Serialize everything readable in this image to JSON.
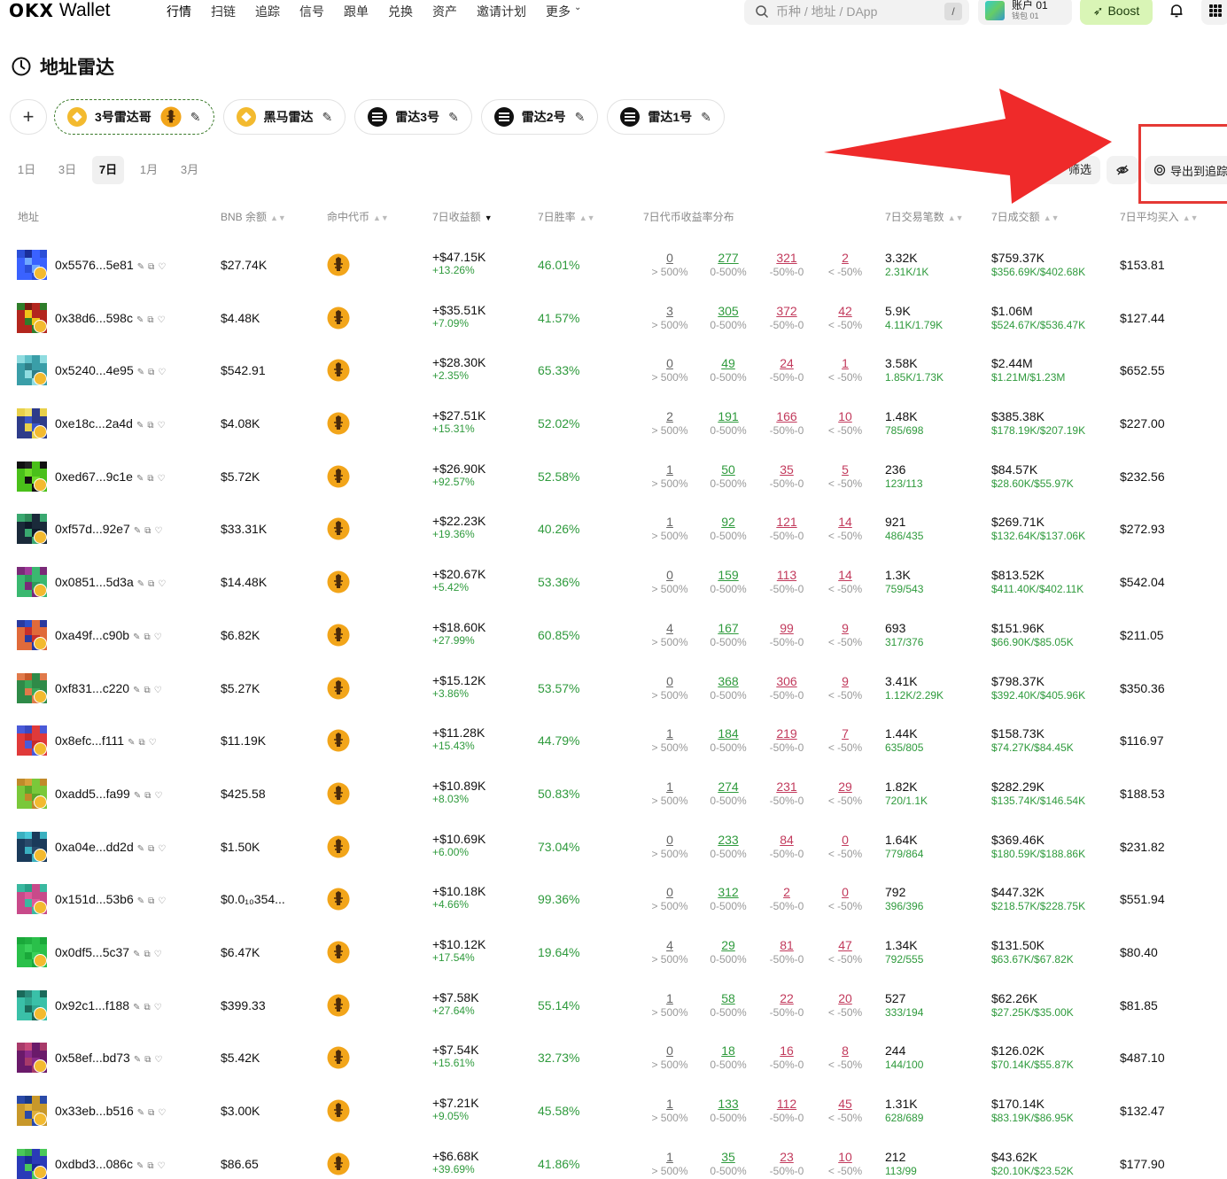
{
  "nav": {
    "logo_mark": "OKX",
    "logo_text": "Wallet",
    "links": [
      "行情",
      "扫链",
      "追踪",
      "信号",
      "跟单",
      "兑换",
      "资产",
      "邀请计划",
      "更多"
    ],
    "search_placeholder": "币种 / 地址 / DApp",
    "search_shortcut": "/",
    "account_name": "账户 01",
    "account_sub": "钱包 01",
    "boost_label": "Boost"
  },
  "page": {
    "title": "地址雷达"
  },
  "radar_tabs": [
    {
      "label": "3号雷达哥",
      "chain": "bnb",
      "selected": true
    },
    {
      "label": "黑马雷达",
      "chain": "bnb",
      "selected": false
    },
    {
      "label": "雷达3号",
      "chain": "sol",
      "selected": false
    },
    {
      "label": "雷达2号",
      "chain": "sol",
      "selected": false
    },
    {
      "label": "雷达1号",
      "chain": "sol",
      "selected": false
    }
  ],
  "add_tab_label": "+",
  "time_filters": [
    "1日",
    "3日",
    "7日",
    "1月",
    "3月"
  ],
  "active_time_filter": "7日",
  "toolbar": {
    "filter_label": "筛选",
    "export_label": "导出到追踪"
  },
  "columns": {
    "address": "地址",
    "balance": "BNB 余额",
    "token": "命中代币",
    "profit": "7日收益额",
    "winrate": "7日胜率",
    "dist": "7日代币收益率分布",
    "txcount": "7日交易笔数",
    "volume": "7日成交额",
    "avgbuy": "7日平均买入"
  },
  "dist_labels": [
    "> 500%",
    "0-500%",
    "-50%-0",
    "< -50%"
  ],
  "rows": [
    {
      "addr": "0x5576...5e81",
      "bal": "$27.74K",
      "profit": "+$47.15K",
      "pct": "+13.26%",
      "win": "46.01%",
      "d": [
        "0",
        "277",
        "321",
        "2"
      ],
      "tx": "3.32K",
      "txs": "2.31K/1K",
      "vol": "$759.37K",
      "vols": "$356.69K/$402.68K",
      "avg": "$153.81",
      "c": [
        "#2b4fd8",
        "#6fa8ff",
        "#1a2f9a",
        "#3a62ff"
      ]
    },
    {
      "addr": "0x38d6...598c",
      "bal": "$4.48K",
      "profit": "+$35.51K",
      "pct": "+7.09%",
      "win": "41.57%",
      "d": [
        "3",
        "305",
        "372",
        "42"
      ],
      "tx": "5.9K",
      "txs": "4.11K/1.79K",
      "vol": "$1.06M",
      "vols": "$524.67K/$536.47K",
      "avg": "$127.44",
      "c": [
        "#b3261e",
        "#2f7d2a",
        "#f0c419",
        "#7a1a12"
      ]
    },
    {
      "addr": "0x5240...4e95",
      "bal": "$542.91",
      "profit": "+$28.30K",
      "pct": "+2.35%",
      "win": "65.33%",
      "d": [
        "0",
        "49",
        "24",
        "1"
      ],
      "tx": "3.58K",
      "txs": "1.85K/1.73K",
      "vol": "$2.44M",
      "vols": "$1.21M/$1.23M",
      "avg": "$652.55",
      "c": [
        "#5fc0c8",
        "#3a9ea8",
        "#8fdce0",
        "#2f7f88"
      ]
    },
    {
      "addr": "0xe18c...2a4d",
      "bal": "$4.08K",
      "profit": "+$27.51K",
      "pct": "+15.31%",
      "win": "52.02%",
      "d": [
        "2",
        "191",
        "166",
        "10"
      ],
      "tx": "1.48K",
      "txs": "785/698",
      "vol": "$385.38K",
      "vols": "$178.19K/$207.19K",
      "avg": "$227.00",
      "c": [
        "#3a56c8",
        "#f2e06a",
        "#2e3c8a",
        "#e8d04a"
      ]
    },
    {
      "addr": "0xed67...9c1e",
      "bal": "$5.72K",
      "profit": "+$26.90K",
      "pct": "+92.57%",
      "win": "52.58%",
      "d": [
        "1",
        "50",
        "35",
        "5"
      ],
      "tx": "236",
      "txs": "123/113",
      "vol": "$84.57K",
      "vols": "$28.60K/$55.97K",
      "avg": "$232.56",
      "c": [
        "#111111",
        "#6fdc2a",
        "#222222",
        "#4ac01a"
      ]
    },
    {
      "addr": "0xf57d...92e7",
      "bal": "$33.31K",
      "profit": "+$22.23K",
      "pct": "+19.36%",
      "win": "40.26%",
      "d": [
        "1",
        "92",
        "121",
        "14"
      ],
      "tx": "921",
      "txs": "486/435",
      "vol": "$269.71K",
      "vols": "$132.64K/$137.06K",
      "avg": "$272.93",
      "c": [
        "#1a2a3a",
        "#3aa870",
        "#0f1a2a",
        "#2f8a5a"
      ]
    },
    {
      "addr": "0x0851...5d3a",
      "bal": "$14.48K",
      "profit": "+$20.67K",
      "pct": "+5.42%",
      "win": "53.36%",
      "d": [
        "0",
        "159",
        "113",
        "14"
      ],
      "tx": "1.3K",
      "txs": "759/543",
      "vol": "$813.52K",
      "vols": "$411.40K/$402.11K",
      "avg": "$542.04",
      "c": [
        "#a03a9a",
        "#3ab870",
        "#7a2a78",
        "#2f9a5a"
      ]
    },
    {
      "addr": "0xa49f...c90b",
      "bal": "$6.82K",
      "profit": "+$18.60K",
      "pct": "+27.99%",
      "win": "60.85%",
      "d": [
        "4",
        "167",
        "99",
        "9"
      ],
      "tx": "693",
      "txs": "317/376",
      "vol": "$151.96K",
      "vols": "$66.90K/$85.05K",
      "avg": "$211.05",
      "c": [
        "#c8302a",
        "#3050c8",
        "#e06a3a",
        "#2a3aa0"
      ]
    },
    {
      "addr": "0xf831...c220",
      "bal": "$5.27K",
      "profit": "+$15.12K",
      "pct": "+3.86%",
      "win": "53.57%",
      "d": [
        "0",
        "368",
        "306",
        "9"
      ],
      "tx": "3.41K",
      "txs": "1.12K/2.29K",
      "vol": "$798.37K",
      "vols": "$392.40K/$405.96K",
      "avg": "$350.36",
      "c": [
        "#e07a4a",
        "#3aa858",
        "#c85a2a",
        "#2f8a48"
      ]
    },
    {
      "addr": "0x8efc...f111",
      "bal": "$11.19K",
      "profit": "+$11.28K",
      "pct": "+15.43%",
      "win": "44.79%",
      "d": [
        "1",
        "184",
        "219",
        "7"
      ],
      "tx": "1.44K",
      "txs": "635/805",
      "vol": "$158.73K",
      "vols": "$74.27K/$84.45K",
      "avg": "$116.97",
      "c": [
        "#e03a3a",
        "#4a5ad8",
        "#c82a2a",
        "#3a4ac0"
      ]
    },
    {
      "addr": "0xadd5...fa99",
      "bal": "$425.58",
      "profit": "+$10.89K",
      "pct": "+8.03%",
      "win": "50.83%",
      "d": [
        "1",
        "274",
        "231",
        "29"
      ],
      "tx": "1.82K",
      "txs": "720/1.1K",
      "vol": "$282.29K",
      "vols": "$135.74K/$146.54K",
      "avg": "$188.53",
      "c": [
        "#d8a03a",
        "#7ac83a",
        "#c08a2a",
        "#5aa82a"
      ]
    },
    {
      "addr": "0xa04e...dd2d",
      "bal": "$1.50K",
      "profit": "+$10.69K",
      "pct": "+6.00%",
      "win": "73.04%",
      "d": [
        "0",
        "233",
        "84",
        "0"
      ],
      "tx": "1.64K",
      "txs": "779/864",
      "vol": "$369.46K",
      "vols": "$180.59K/$188.86K",
      "avg": "$231.82",
      "c": [
        "#2a4a6a",
        "#4ac8d8",
        "#1a3a5a",
        "#3ab0c0"
      ]
    },
    {
      "addr": "0x151d...53b6",
      "bal": "$0.0₁₀354...",
      "profit": "+$10.18K",
      "pct": "+4.66%",
      "win": "99.36%",
      "d": [
        "0",
        "312",
        "2",
        "0"
      ],
      "tx": "792",
      "txs": "396/396",
      "vol": "$447.32K",
      "vols": "$218.57K/$228.75K",
      "avg": "$551.94",
      "c": [
        "#3ab8a0",
        "#e05a9a",
        "#2aa088",
        "#c84a8a"
      ]
    },
    {
      "addr": "0x0df5...5c37",
      "bal": "$6.47K",
      "profit": "+$10.12K",
      "pct": "+17.54%",
      "win": "19.64%",
      "d": [
        "4",
        "29",
        "81",
        "47"
      ],
      "tx": "1.34K",
      "txs": "792/555",
      "vol": "$131.50K",
      "vols": "$63.67K/$67.82K",
      "avg": "$80.40",
      "c": [
        "#2ac04a",
        "#1aa83a",
        "#3ad05a",
        "#20b040"
      ]
    },
    {
      "addr": "0x92c1...f188",
      "bal": "$399.33",
      "profit": "+$7.58K",
      "pct": "+27.64%",
      "win": "55.14%",
      "d": [
        "1",
        "58",
        "22",
        "20"
      ],
      "tx": "527",
      "txs": "333/194",
      "vol": "$62.26K",
      "vols": "$27.25K/$35.00K",
      "avg": "$81.85",
      "c": [
        "#2a8a7a",
        "#3ac0a8",
        "#1a6a5a",
        "#2fa890"
      ]
    },
    {
      "addr": "0x58ef...bd73",
      "bal": "$5.42K",
      "profit": "+$7.54K",
      "pct": "+15.61%",
      "win": "32.73%",
      "d": [
        "0",
        "18",
        "16",
        "8"
      ],
      "tx": "244",
      "txs": "144/100",
      "vol": "$126.02K",
      "vols": "$70.14K/$55.87K",
      "avg": "$487.10",
      "c": [
        "#8a2a8a",
        "#c84a7a",
        "#6a1a6a",
        "#a83a6a"
      ]
    },
    {
      "addr": "0x33eb...b516",
      "bal": "$3.00K",
      "profit": "+$7.21K",
      "pct": "+9.05%",
      "win": "45.58%",
      "d": [
        "1",
        "133",
        "112",
        "45"
      ],
      "tx": "1.31K",
      "txs": "628/689",
      "vol": "$170.14K",
      "vols": "$83.19K/$86.95K",
      "avg": "$132.47",
      "c": [
        "#2a4aa8",
        "#e0b03a",
        "#1a3a88",
        "#c8982a"
      ]
    },
    {
      "addr": "0xdbd3...086c",
      "bal": "$86.65",
      "profit": "+$6.68K",
      "pct": "+39.69%",
      "win": "41.86%",
      "d": [
        "1",
        "35",
        "23",
        "10"
      ],
      "tx": "212",
      "txs": "113/99",
      "vol": "$43.62K",
      "vols": "$20.10K/$23.52K",
      "avg": "$177.90",
      "c": [
        "#2a3ab8",
        "#4ac85a",
        "#1a2a98",
        "#3ab04a"
      ]
    }
  ]
}
